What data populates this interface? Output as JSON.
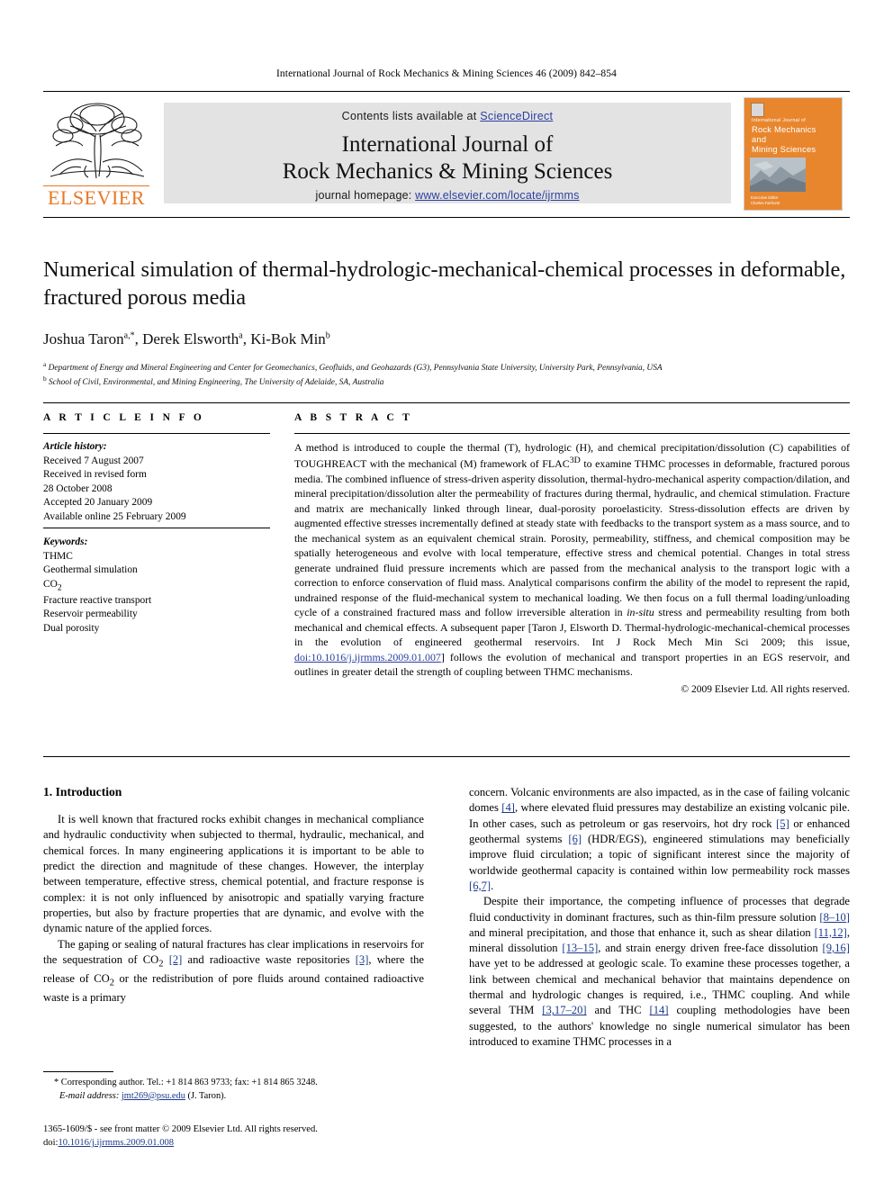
{
  "running_head": "International Journal of Rock Mechanics & Mining Sciences 46 (2009) 842–854",
  "masthead": {
    "contents_prefix": "Contents lists available at ",
    "sciencedirect": "ScienceDirect",
    "journal_title_line1": "International Journal of",
    "journal_title_line2": "Rock Mechanics & Mining Sciences",
    "homepage_prefix": "journal homepage: ",
    "homepage_url": "www.elsevier.com/locate/ijrmms",
    "publisher": "ELSEVIER",
    "cover": {
      "sub": "International Journal of",
      "line1": "Rock Mechanics",
      "line2": "and",
      "line3": "Mining Sciences",
      "foot1": "Executive Editor",
      "foot2": "Charles Fairhurst"
    },
    "colors": {
      "link_blue": "#2B3FA0",
      "elsevier_orange": "#E87722",
      "cover_orange": "#E8862E",
      "band_grey": "#E3E3E3"
    }
  },
  "article": {
    "title": "Numerical simulation of thermal-hydrologic-mechanical-chemical processes in deformable, fractured porous media",
    "authors": "Joshua Taron a,*, Derek Elsworth a, Ki-Bok Min b",
    "affiliation_a": "Department of Energy and Mineral Engineering and Center for Geomechanics, Geofluids, and Geohazards (G3), Pennsylvania State University, University Park, Pennsylvania, USA",
    "affiliation_b": "School of Civil, Environmental, and Mining Engineering, The University of Adelaide, SA, Australia"
  },
  "article_info": {
    "heading": "A R T I C L E  I N F O",
    "history_label": "Article history:",
    "history": [
      "Received 7 August 2007",
      "Received in revised form",
      "28 October 2008",
      "Accepted 20 January 2009",
      "Available online 25 February 2009"
    ],
    "keywords_label": "Keywords:",
    "keywords": [
      "THMC",
      "Geothermal simulation",
      "CO2",
      "Fracture reactive transport",
      "Reservoir permeability",
      "Dual porosity"
    ]
  },
  "abstract": {
    "heading": "A B S T R A C T",
    "part1": "A method is introduced to couple the thermal (T), hydrologic (H), and chemical precipitation/dissolution (C) capabilities of TOUGHREACT with the mechanical (M) framework of FLAC",
    "flac_sup": "3D",
    "part2": " to examine THMC processes in deformable, fractured porous media. The combined influence of stress-driven asperity dissolution, thermal-hydro-mechanical asperity compaction/dilation, and mineral precipitation/dissolution alter the permeability of fractures during thermal, hydraulic, and chemical stimulation. Fracture and matrix are mechanically linked through linear, dual-porosity poroelasticity. Stress-dissolution effects are driven by augmented effective stresses incrementally defined at steady state with feedbacks to the transport system as a mass source, and to the mechanical system as an equivalent chemical strain. Porosity, permeability, stiffness, and chemical composition may be spatially heterogeneous and evolve with local temperature, effective stress and chemical potential. Changes in total stress generate undrained fluid pressure increments which are passed from the mechanical analysis to the transport logic with a correction to enforce conservation of fluid mass. Analytical comparisons confirm the ability of the model to represent the rapid, undrained response of the fluid-mechanical system to mechanical loading. We then focus on a full thermal loading/unloading cycle of a constrained fractured mass and follow irreversible alteration in ",
    "in_situ": "in-situ",
    "part3": " stress and permeability resulting from both mechanical and chemical effects. A subsequent paper [Taron J, Elsworth D. Thermal-hydrologic-mechanical-chemical processes in the evolution of engineered geothermal reservoirs. Int J Rock Mech Min Sci 2009; this issue, ",
    "doi_link": "doi:10.1016/j.ijrmms.2009.01.007",
    "part4": "] follows the evolution of mechanical and transport properties in an EGS reservoir, and outlines in greater detail the strength of coupling between THMC mechanisms.",
    "copyright": "© 2009 Elsevier Ltd. All rights reserved."
  },
  "body": {
    "section_heading": "1. Introduction",
    "left_p1": "It is well known that fractured rocks exhibit changes in mechanical compliance and hydraulic conductivity when subjected to thermal, hydraulic, mechanical, and chemical forces. In many engineering applications it is important to be able to predict the direction and magnitude of these changes. However, the interplay between temperature, effective stress, chemical potential, and fracture response is complex: it is not only influenced by anisotropic and spatially varying fracture properties, but also by fracture properties that are dynamic, and evolve with the dynamic nature of the applied forces.",
    "left_p2_a": "The gaping or sealing of natural fractures has clear implications in reservoirs for the sequestration of CO",
    "left_p2_sub": "2",
    "left_p2_b": " ",
    "left_p2_ref1": "[2]",
    "left_p2_c": " and radioactive waste repositories ",
    "left_p2_ref2": "[3]",
    "left_p2_d": ", where the release of CO",
    "left_p2_e": " or the redistribution of pore fluids around contained radioactive waste is a primary",
    "right_p1_a": "concern. Volcanic environments are also impacted, as in the case of failing volcanic domes ",
    "right_p1_ref1": "[4]",
    "right_p1_b": ", where elevated fluid pressures may destabilize an existing volcanic pile. In other cases, such as petroleum or gas reservoirs, hot dry rock ",
    "right_p1_ref2": "[5]",
    "right_p1_c": " or enhanced geothermal systems ",
    "right_p1_ref3": "[6]",
    "right_p1_d": " (HDR/EGS), engineered stimulations may beneficially improve fluid circulation; a topic of significant interest since the majority of worldwide geothermal capacity is contained within low permeability rock masses ",
    "right_p1_ref4": "[6,7]",
    "right_p1_e": ".",
    "right_p2_a": "Despite their importance, the competing influence of processes that degrade fluid conductivity in dominant fractures, such as thin-film pressure solution ",
    "right_p2_ref1": "[8–10]",
    "right_p2_b": " and mineral precipitation, and those that enhance it, such as shear dilation ",
    "right_p2_ref2": "[11,12]",
    "right_p2_c": ", mineral dissolution ",
    "right_p2_ref3": "[13–15]",
    "right_p2_d": ", and strain energy driven free-face dissolution ",
    "right_p2_ref4": "[9,16]",
    "right_p2_e": " have yet to be addressed at geologic scale. To examine these processes together, a link between chemical and mechanical behavior that maintains dependence on thermal and hydrologic changes is required, i.e., THMC coupling. And while several THM ",
    "right_p2_ref5": "[3,17–20]",
    "right_p2_f": " and THC ",
    "right_p2_ref6": "[14]",
    "right_p2_g": " coupling methodologies have been suggested, to the authors' knowledge no single numerical simulator has been introduced to examine THMC processes in a"
  },
  "footnotes": {
    "corresponding": "* Corresponding author. Tel.: +1 814 863 9733; fax: +1 814 865 3248.",
    "email_label": "E-mail address:",
    "email": "jmt269@psu.edu",
    "email_suffix": "(J. Taron).",
    "issn_line": "1365-1609/$ - see front matter © 2009 Elsevier Ltd. All rights reserved.",
    "doi_label": "doi:",
    "doi_value": "10.1016/j.ijrmms.2009.01.008"
  }
}
